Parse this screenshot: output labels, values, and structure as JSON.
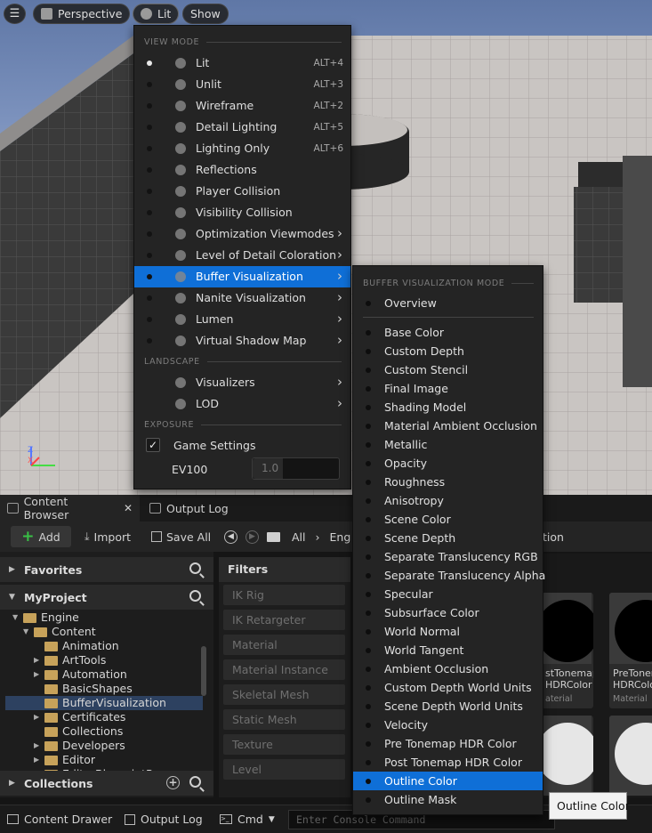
{
  "viewport_toolbar": {
    "perspective": "Perspective",
    "lit": "Lit",
    "show": "Show"
  },
  "view_menu": {
    "section_view_mode": "VIEW MODE",
    "section_landscape": "LANDSCAPE",
    "section_exposure": "EXPOSURE",
    "items": [
      {
        "label": "Lit",
        "shortcut": "ALT+4",
        "selected": true
      },
      {
        "label": "Unlit",
        "shortcut": "ALT+3"
      },
      {
        "label": "Wireframe",
        "shortcut": "ALT+2"
      },
      {
        "label": "Detail Lighting",
        "shortcut": "ALT+5"
      },
      {
        "label": "Lighting Only",
        "shortcut": "ALT+6"
      },
      {
        "label": "Reflections",
        "shortcut": ""
      },
      {
        "label": "Player Collision",
        "shortcut": ""
      },
      {
        "label": "Visibility Collision",
        "shortcut": ""
      },
      {
        "label": "Optimization Viewmodes",
        "submenu": true
      },
      {
        "label": "Level of Detail Coloration",
        "submenu": true
      },
      {
        "label": "Buffer Visualization",
        "submenu": true,
        "highlighted": true
      },
      {
        "label": "Nanite Visualization",
        "submenu": true
      },
      {
        "label": "Lumen",
        "submenu": true
      },
      {
        "label": "Virtual Shadow Map",
        "submenu": true
      }
    ],
    "landscape_items": [
      {
        "label": "Visualizers",
        "submenu": true
      },
      {
        "label": "LOD",
        "submenu": true
      }
    ],
    "game_settings_label": "Game Settings",
    "game_settings_checked": true,
    "ev100_label": "EV100",
    "ev100_value": "1.0"
  },
  "buffer_menu": {
    "section_title": "BUFFER VISUALIZATION MODE",
    "overview": "Overview",
    "items": [
      "Base Color",
      "Custom Depth",
      "Custom Stencil",
      "Final Image",
      "Shading Model",
      "Material Ambient Occlusion",
      "Metallic",
      "Opacity",
      "Roughness",
      "Anisotropy",
      "Scene Color",
      "Scene Depth",
      "Separate Translucency RGB",
      "Separate Translucency Alpha",
      "Specular",
      "Subsurface Color",
      "World Normal",
      "World Tangent",
      "Ambient Occlusion",
      "Custom Depth World Units",
      "Scene Depth World Units",
      "Velocity",
      "Pre Tonemap HDR Color",
      "Post Tonemap HDR Color",
      "Outline Color",
      "Outline Mask"
    ],
    "highlighted": "Outline Color"
  },
  "tooltip": "Outline Color",
  "tabs": {
    "content_browser": "Content Browser",
    "output_log": "Output Log"
  },
  "toolbar": {
    "add": "Add",
    "import": "Import",
    "save_all": "Save All",
    "path_all": "All",
    "path_engine": "Eng",
    "path_tail": "tion"
  },
  "left_panel": {
    "favorites": "Favorites",
    "project": "MyProject",
    "collections": "Collections",
    "tree": [
      {
        "label": "Engine",
        "depth": 1,
        "open": true
      },
      {
        "label": "Content",
        "depth": 2,
        "open": true
      },
      {
        "label": "Animation",
        "depth": 3
      },
      {
        "label": "ArtTools",
        "depth": 3,
        "children": true
      },
      {
        "label": "Automation",
        "depth": 3,
        "children": true
      },
      {
        "label": "BasicShapes",
        "depth": 3
      },
      {
        "label": "BufferVisualization",
        "depth": 3,
        "selected": true
      },
      {
        "label": "Certificates",
        "depth": 3,
        "children": true
      },
      {
        "label": "Collections",
        "depth": 3
      },
      {
        "label": "Developers",
        "depth": 3,
        "children": true
      },
      {
        "label": "Editor",
        "depth": 3,
        "children": true
      },
      {
        "label": "EditorBlueprintResources",
        "depth": 3
      }
    ]
  },
  "filters": {
    "title": "Filters",
    "items": [
      "IK Rig",
      "IK Retargeter",
      "Material",
      "Material Instance",
      "Skeletal Mesh",
      "Static Mesh",
      "Texture",
      "Level"
    ]
  },
  "search_placeholder_tail": "on",
  "assets": [
    {
      "name_line1": "stTonemap",
      "name_line2": "HDRColor",
      "kind": "aterial"
    },
    {
      "name_line1": "PreTonem",
      "name_line2": "HDRColo",
      "kind": "Material"
    }
  ],
  "statusbar": {
    "content_drawer": "Content Drawer",
    "output_log": "Output Log",
    "cmd": "Cmd",
    "console_placeholder": "Enter Console Command"
  },
  "colors": {
    "highlight": "#0f6fd7",
    "menu_bg": "#242424",
    "folder": "#c7a25a",
    "add_plus": "#39c046"
  }
}
